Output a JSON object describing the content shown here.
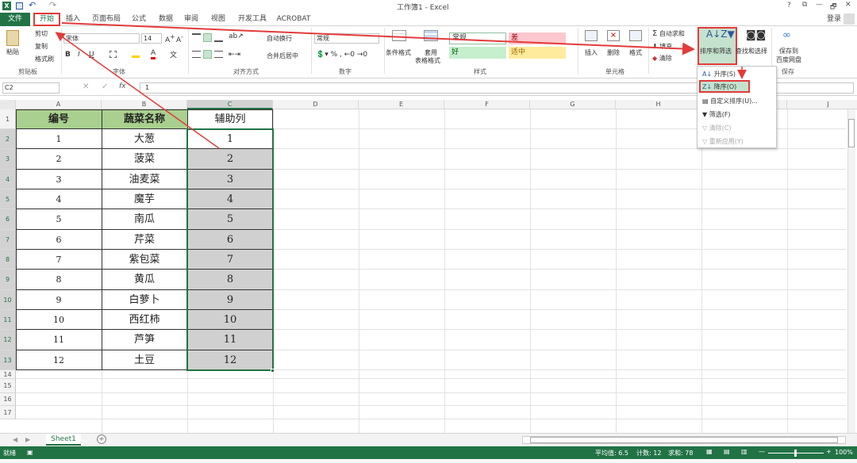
{
  "title": "工作簿1 - Excel",
  "window_controls": {
    "help": "?",
    "restore": "⧉",
    "minimize": "—",
    "maximize": "🗗",
    "close": "✕"
  },
  "login": "登录",
  "tabs": {
    "file": "文件",
    "home": "开始",
    "insert": "插入",
    "layout": "页面布局",
    "formula": "公式",
    "data": "数据",
    "review": "审阅",
    "view": "视图",
    "dev": "开发工具",
    "acrobat": "ACROBAT"
  },
  "ribbon": {
    "paste": "粘贴",
    "cut": "剪切",
    "copy": "复制",
    "format_painter": "格式刷",
    "clipboard": "剪贴板",
    "font_name": "宋体",
    "font_size": "14",
    "font_group": "字体",
    "wrap": "自动换行",
    "merge": "合并后居中",
    "align_group": "对齐方式",
    "num_format": "常规",
    "number_group": "数字",
    "cond_format": "条件格式",
    "table_format_1": "套用",
    "table_format_2": "表格格式",
    "style_normal": "常规",
    "style_bad": "差",
    "style_good": "好",
    "style_neutral": "适中",
    "styles_group": "样式",
    "insert": "插入",
    "delete": "删除",
    "format": "格式",
    "cells_group": "单元格",
    "autosum": "自动求和",
    "fill": "填充",
    "clear": "清除",
    "sort_filter": "排序和筛选",
    "find_select": "查找和选择",
    "save_baidu_1": "保存到",
    "save_baidu_2": "百度网盘",
    "save_group": "保存"
  },
  "sort_menu": {
    "asc": "升序(S)",
    "desc": "降序(O)",
    "custom": "自定义排序(U)...",
    "filter": "筛选(F)",
    "clear": "清除(C)",
    "reapply": "重新应用(Y)"
  },
  "formula_bar": {
    "name_box": "C2",
    "fx": "fx",
    "value": "1"
  },
  "columns": [
    "A",
    "B",
    "C",
    "D",
    "E",
    "F",
    "G",
    "H",
    "I",
    "J"
  ],
  "rows": [
    "1",
    "2",
    "3",
    "4",
    "5",
    "6",
    "7",
    "8",
    "9",
    "10",
    "11",
    "12",
    "13",
    "14",
    "15",
    "16",
    "17"
  ],
  "table": {
    "headers": [
      "编号",
      "蔬菜名称",
      "辅助列"
    ],
    "data": [
      [
        "1",
        "大葱",
        "1"
      ],
      [
        "2",
        "菠菜",
        "2"
      ],
      [
        "3",
        "油麦菜",
        "3"
      ],
      [
        "4",
        "魔芋",
        "4"
      ],
      [
        "5",
        "南瓜",
        "5"
      ],
      [
        "6",
        "芹菜",
        "6"
      ],
      [
        "7",
        "紫包菜",
        "7"
      ],
      [
        "8",
        "黄瓜",
        "8"
      ],
      [
        "9",
        "白萝卜",
        "9"
      ],
      [
        "10",
        "西红柿",
        "10"
      ],
      [
        "11",
        "芦笋",
        "11"
      ],
      [
        "12",
        "土豆",
        "12"
      ]
    ]
  },
  "sheet_tab": "Sheet1",
  "status": {
    "ready": "就绪",
    "average": "平均值: 6.5",
    "count": "计数: 12",
    "sum": "求和: 78",
    "zoom": "100%"
  },
  "colors": {
    "excel_green": "#217346",
    "header_green": "#a9d08e",
    "selection_gray": "#d0d0d0",
    "annotation_red": "#e23b3b"
  }
}
